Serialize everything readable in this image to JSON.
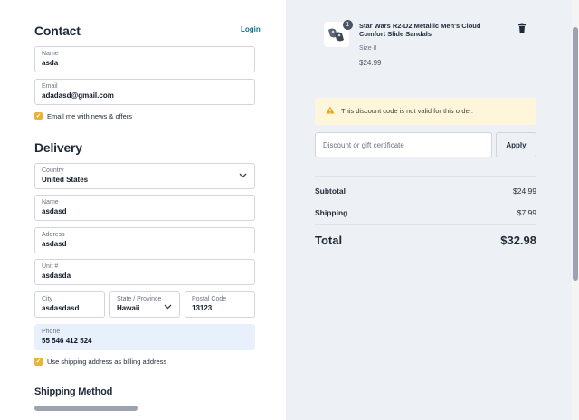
{
  "contact": {
    "heading": "Contact",
    "login_link": "Login",
    "name": {
      "label": "Name",
      "value": "asda"
    },
    "email": {
      "label": "Email",
      "value": "adadasd@gmail.com"
    },
    "newsletter": {
      "label": "Email me with news & offers",
      "checked": true
    }
  },
  "delivery": {
    "heading": "Delivery",
    "country": {
      "label": "Country",
      "value": "United States"
    },
    "name": {
      "label": "Name",
      "value": "asdasd"
    },
    "address": {
      "label": "Address",
      "value": "asdasd"
    },
    "unit": {
      "label": "Unit #",
      "value": "asdasda"
    },
    "city": {
      "label": "City",
      "value": "asdasdasd"
    },
    "state": {
      "label": "State / Province",
      "value": "Hawaii"
    },
    "postal": {
      "label": "Postal Code",
      "value": "13123"
    },
    "phone": {
      "label": "Phone",
      "value": "55 546 412 524"
    },
    "billing_same": {
      "label": "Use shipping address as billing address",
      "checked": true
    }
  },
  "shipping_method": {
    "heading": "Shipping Method"
  },
  "cart": {
    "item": {
      "quantity": "1",
      "title": "Star Wars R2-D2 Metallic Men's Cloud Comfort Slide Sandals",
      "size": "Size 8",
      "price": "$24.99"
    },
    "alert": "This discount code is not valid for this order.",
    "discount_placeholder": "Discount or gift certificate",
    "apply_label": "Apply",
    "subtotal_label": "Subtotal",
    "subtotal_value": "$24.99",
    "shipping_label": "Shipping",
    "shipping_value": "$7.99",
    "total_label": "Total",
    "total_value": "$32.98"
  },
  "colors": {
    "accent": "#e9b23a",
    "link": "#0e7490",
    "alert_bg": "#fdf6da",
    "summary_bg": "#edf1f6"
  },
  "icons": [
    "trash-icon",
    "warning-icon",
    "chevron-down-icon",
    "check-icon"
  ]
}
